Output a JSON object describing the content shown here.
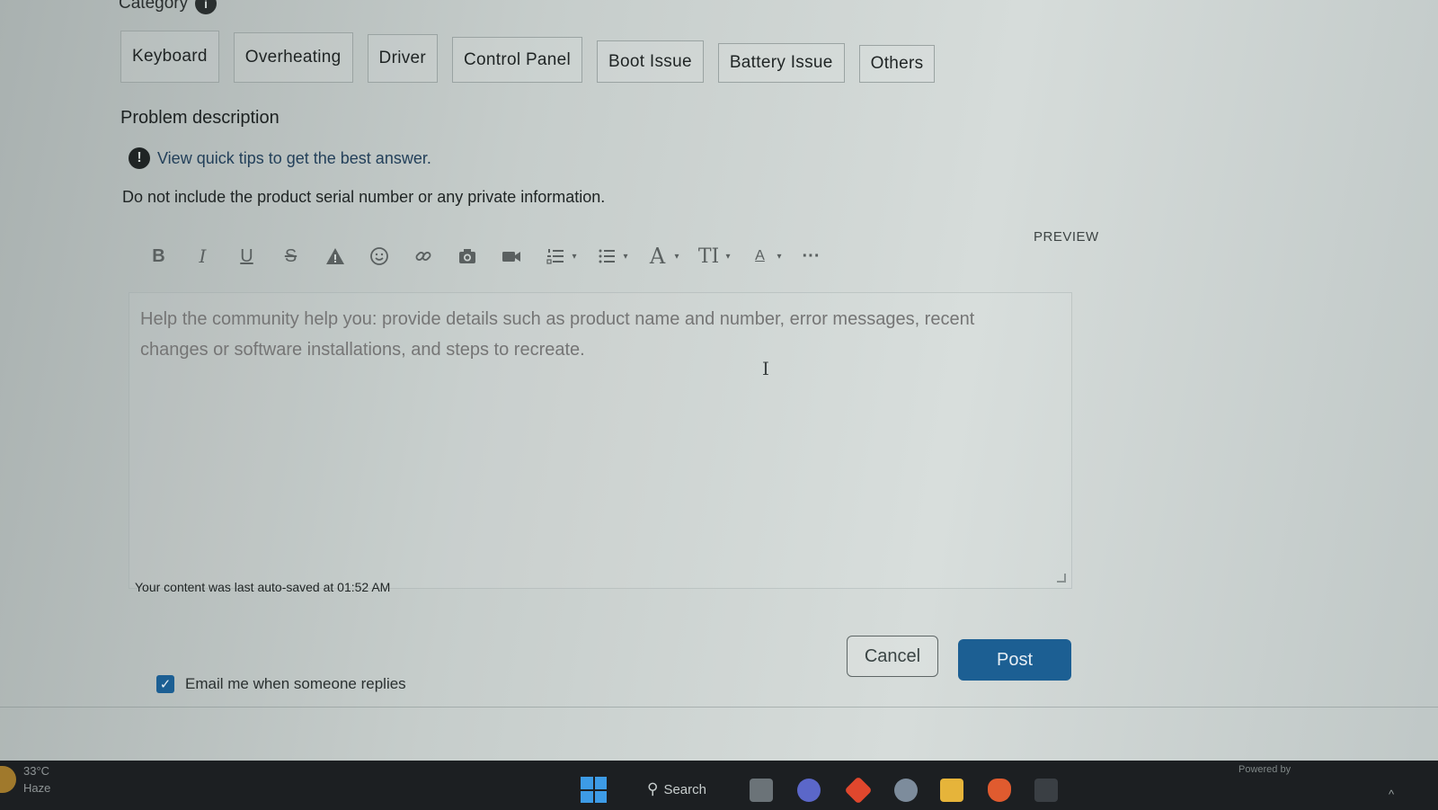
{
  "category": {
    "heading": "Category",
    "info_glyph": "i"
  },
  "chips": [
    "Keyboard",
    "Overheating",
    "Driver",
    "Control Panel",
    "Boot Issue",
    "Battery Issue",
    "Others"
  ],
  "problem": {
    "title": "Problem description",
    "tips_glyph": "!",
    "tips_link": "View quick tips to get the best answer.",
    "privacy_note": "Do not include the product serial number or any private information."
  },
  "editor": {
    "preview_label": "PREVIEW",
    "placeholder": "Help the community help you: provide details such as product name and number, error messages, recent changes or software installations, and steps to recreate.",
    "cursor_glyph": "I",
    "toolbar_icons": [
      "bold-icon",
      "italic-icon",
      "underline-icon",
      "strikethrough-icon",
      "text-color-icon",
      "emoji-icon",
      "link-icon",
      "camera-icon",
      "video-icon",
      "ordered-list-icon",
      "unordered-list-icon",
      "font-family-icon",
      "font-size-icon",
      "text-style-icon",
      "more-icon"
    ],
    "glyphs": {
      "bold": "B",
      "italic": "I",
      "underline": "U",
      "strike": "S",
      "font": "A",
      "size": "TI",
      "style": "A",
      "more": "···",
      "caret": "▾"
    }
  },
  "autosave_text": "Your content was last auto-saved at 01:52 AM",
  "buttons": {
    "cancel": "Cancel",
    "post": "Post"
  },
  "email_option": {
    "label": "Email me when someone replies",
    "checked": true,
    "check_glyph": "✓"
  },
  "taskbar": {
    "weather_temp": "33°C",
    "weather_desc": "Haze",
    "search_label": "Search",
    "search_glyph": "⚲",
    "powered_by": "Powered by",
    "tray_glyph": "^"
  },
  "colors": {
    "primary": "#1c5f93",
    "taskbar": "#1c1f22",
    "link": "#23405a"
  }
}
